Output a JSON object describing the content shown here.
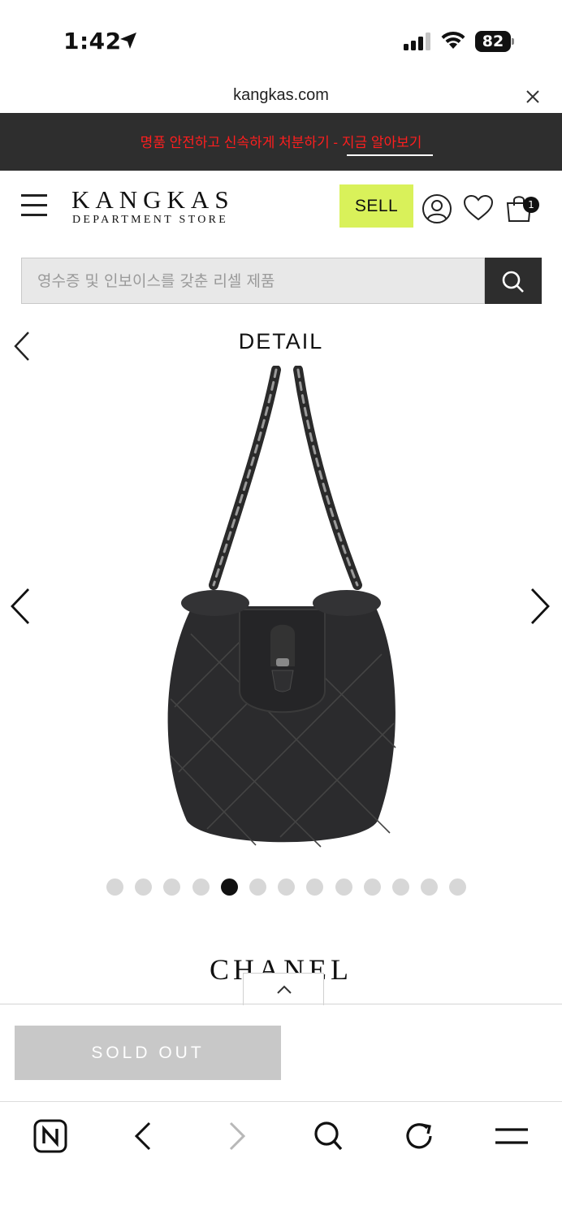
{
  "status_bar": {
    "time": "1:42",
    "battery": "82"
  },
  "browser": {
    "url": "kangkas.com"
  },
  "promo": {
    "text_main": "명품 안전하고 신속하게 처분하기 - ",
    "text_link": "지금 알아보기",
    "color": "#ff1e1e"
  },
  "header": {
    "logo_main": "KANGKAS",
    "logo_sub": "DEPARTMENT STORE",
    "sell_label": "SELL",
    "sell_color": "#d9f15a",
    "cart_count": "1"
  },
  "search": {
    "placeholder": "영수증 및 인보이스를 갖춘 리셀 제품"
  },
  "detail": {
    "title": "DETAIL",
    "image_count": 13,
    "active_image_index": 4,
    "brand": "CHANEL",
    "sold_out_label": "SOLD OUT"
  },
  "toolbar": {
    "items": [
      "naver-n-icon",
      "back-icon",
      "forward-icon",
      "search-icon",
      "refresh-icon",
      "menu-icon"
    ]
  }
}
